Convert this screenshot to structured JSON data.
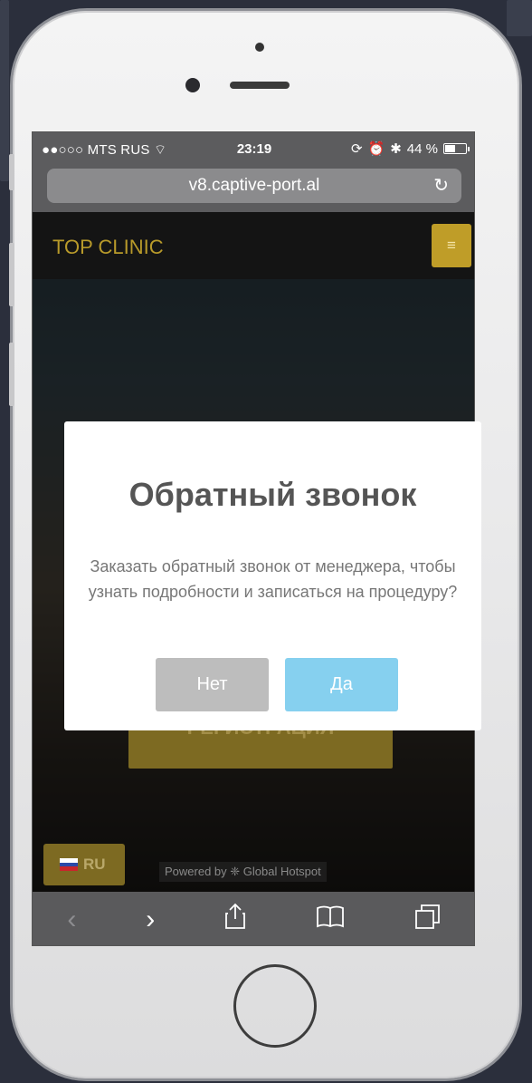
{
  "status_bar": {
    "carrier": "●●○○○ MTS RUS",
    "time": "23:19",
    "battery": "44 %"
  },
  "browser": {
    "url": "v8.captive-port.al",
    "reload_icon": "reload-icon"
  },
  "site": {
    "brand": "TOP CLINIC",
    "menu_icon": "hamburger-icon",
    "register_label": "РЕГИСТРАЦИЯ",
    "language": "RU",
    "powered_by": "Powered by  ❈ Global Hotspot"
  },
  "modal": {
    "title": "Обратный звонок",
    "text": "Заказать обратный звонок от менеджера, чтобы узнать подробности и записаться на процедуру?",
    "no_label": "Нет",
    "yes_label": "Да"
  },
  "toolbar": {
    "back": "‹",
    "forward": "›"
  },
  "colors": {
    "brand": "#b89a2a",
    "yes_button": "#86d0ef",
    "no_button": "#bdbdbd"
  }
}
